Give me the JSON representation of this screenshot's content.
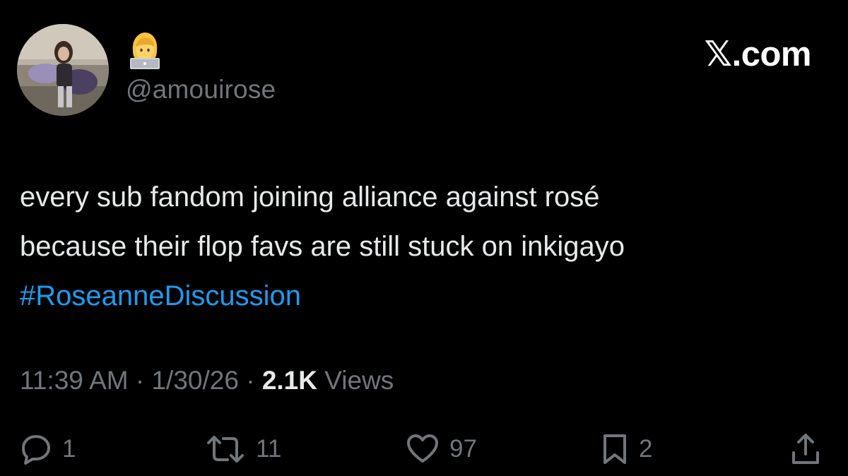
{
  "profile": {
    "handle": "@amouirose",
    "display_name_icon": "technologist-emoji"
  },
  "brand": "𝕏.com",
  "tweet": {
    "lines": [
      "every sub fandom joining alliance against rosé",
      "because their flop favs are still stuck on inkigayo"
    ],
    "hashtag": "#RoseanneDiscussion"
  },
  "meta": {
    "time": "11:39 AM",
    "separator": "·",
    "date": "1/30/26",
    "views_count": "2.1K",
    "views_label": "Views"
  },
  "actions": {
    "reply_count": "1",
    "repost_count": "11",
    "like_count": "97",
    "bookmark_count": "2"
  },
  "colors": {
    "background": "#000000",
    "text": "#e7e9ea",
    "secondary": "#71767b",
    "accent": "#1d9bf0"
  }
}
